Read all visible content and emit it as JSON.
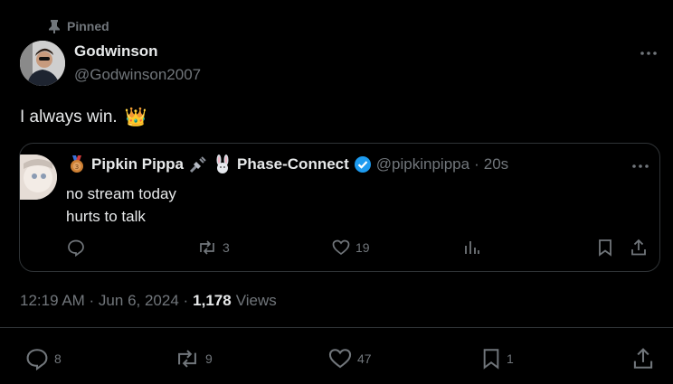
{
  "pinned_label": "Pinned",
  "author": {
    "name": "Godwinson",
    "handle": "@Godwinson2007"
  },
  "tweet": {
    "text": "I always win.",
    "emoji": "👑"
  },
  "quote": {
    "display_name": "Pipkin Pippa",
    "display_name_suffix": "Phase-Connect",
    "handle": "@pipkinpippa",
    "separator": "·",
    "time": "20s",
    "lines": [
      "no stream today",
      "hurts to talk"
    ],
    "retweets": "3",
    "likes": "19"
  },
  "meta": {
    "time": "12:19 AM · Jun 6, 2024 ·",
    "views_count": "1,178",
    "views_label": "Views"
  },
  "actions": {
    "replies": "8",
    "retweets": "9",
    "likes": "47",
    "bookmarks": "1"
  },
  "colors": {
    "background": "#000000",
    "text": "#e7e9ea",
    "muted": "#71767b",
    "verified": "#1d9bf0",
    "border": "#2f3336"
  },
  "icons": [
    "pin-icon",
    "more-icon",
    "medal-icon",
    "plug-icon",
    "rabbit-icon",
    "verified-icon",
    "reply-icon",
    "retweet-icon",
    "like-icon",
    "views-chart-icon",
    "bookmark-icon",
    "share-icon"
  ]
}
